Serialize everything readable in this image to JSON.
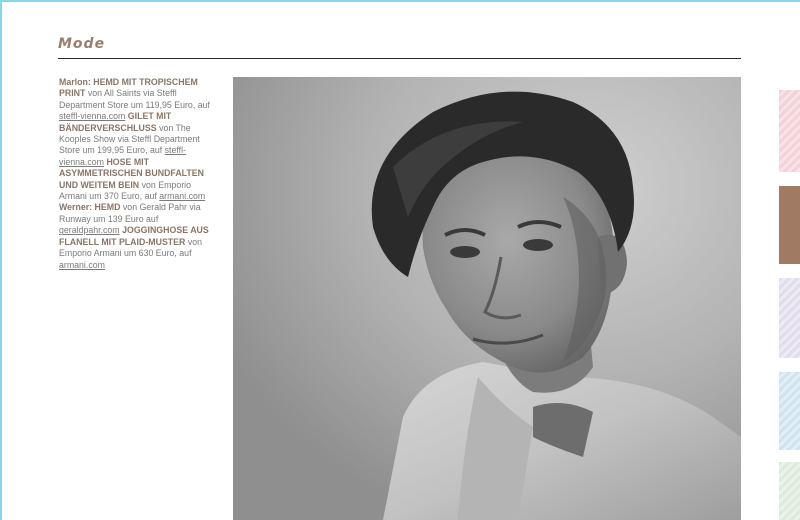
{
  "section": {
    "title": "Mode"
  },
  "credits": {
    "p1_name": "Marlon:",
    "p1_item1_title": "HEMD MIT TROPISCHEM PRINT",
    "p1_item1_text": "von All Saints via Steffl Department Store um 119,95 Euro, auf",
    "p1_item1_link": "steffl-vienna.com",
    "p1_item2_title": "GILET MIT BÄNDERVERSCHLUSS",
    "p1_item2_text": "von The Kooples Show via Steffl Department Store um 199,95 Euro, auf",
    "p1_item2_link": "steffl-vienna.com",
    "p1_item3_title": "HOSE MIT ASYMMETRISCHEN BUNDFALTEN UND WEITEM BEIN",
    "p1_item3_text": "von Emporio Armani um 370 Euro, auf",
    "p1_item3_link": "armani.com",
    "p2_name": "Werner:",
    "p2_item1_title": "HEMD",
    "p2_item1_text": "von Gerald Pahr via Runway um 139 Euro auf",
    "p2_item1_link": "geraldpahr.com",
    "p2_item2_title": "JOGGINGHOSE AUS FLANELL MIT PLAID-MUSTER",
    "p2_item2_text": "von Emporio Armani um 630 Euro, auf",
    "p2_item2_link": "armani.com"
  },
  "photo": {
    "description_icon": "portrait-photo"
  },
  "colors": {
    "accent": "#9a7f6e",
    "frame": "#8fd3e6",
    "swatch_pink": "#f3d3d9",
    "swatch_brown": "#a07a63",
    "swatch_lavender": "#e1ddec",
    "swatch_blue": "#cfe3ef",
    "swatch_green": "#dcebdc"
  }
}
